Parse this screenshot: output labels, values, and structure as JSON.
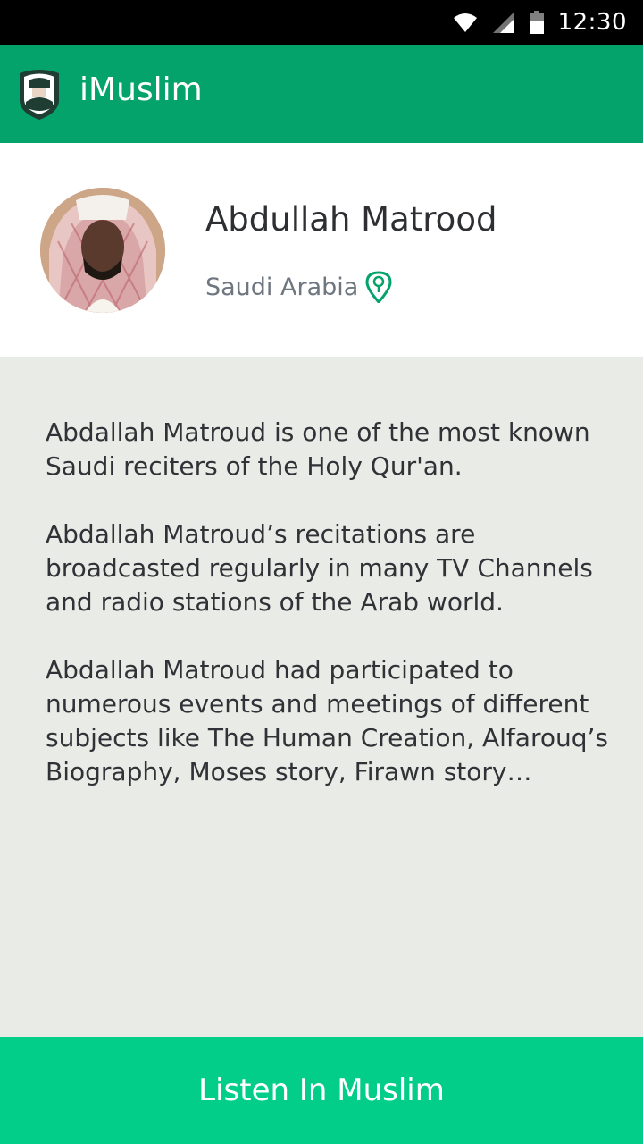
{
  "status_bar": {
    "time": "12:30",
    "icons": [
      "wifi-icon",
      "signal-icon",
      "battery-icon"
    ]
  },
  "app_bar": {
    "title": "iMuslim",
    "logo_icon": "muslim-man-logo-icon",
    "color": "#05a36c"
  },
  "profile": {
    "name": "Abdullah Matrood",
    "country": "Saudi Arabia",
    "location_icon": "location-pin-icon"
  },
  "bio": {
    "paragraphs": [
      "Abdallah Matroud is one of the most known Saudi reciters of the Holy Qur'an.",
      "Abdallah Matroud’s recitations are broadcasted regularly in many TV Channels and radio stations of the Arab world.",
      "Abdallah Matroud had participated to numerous events and meetings of different subjects like The Human Creation, Alfarouq’s Biography, Moses story, Firawn story…"
    ]
  },
  "listen_button": {
    "label": "Listen In Muslim",
    "color": "#02cd89"
  }
}
